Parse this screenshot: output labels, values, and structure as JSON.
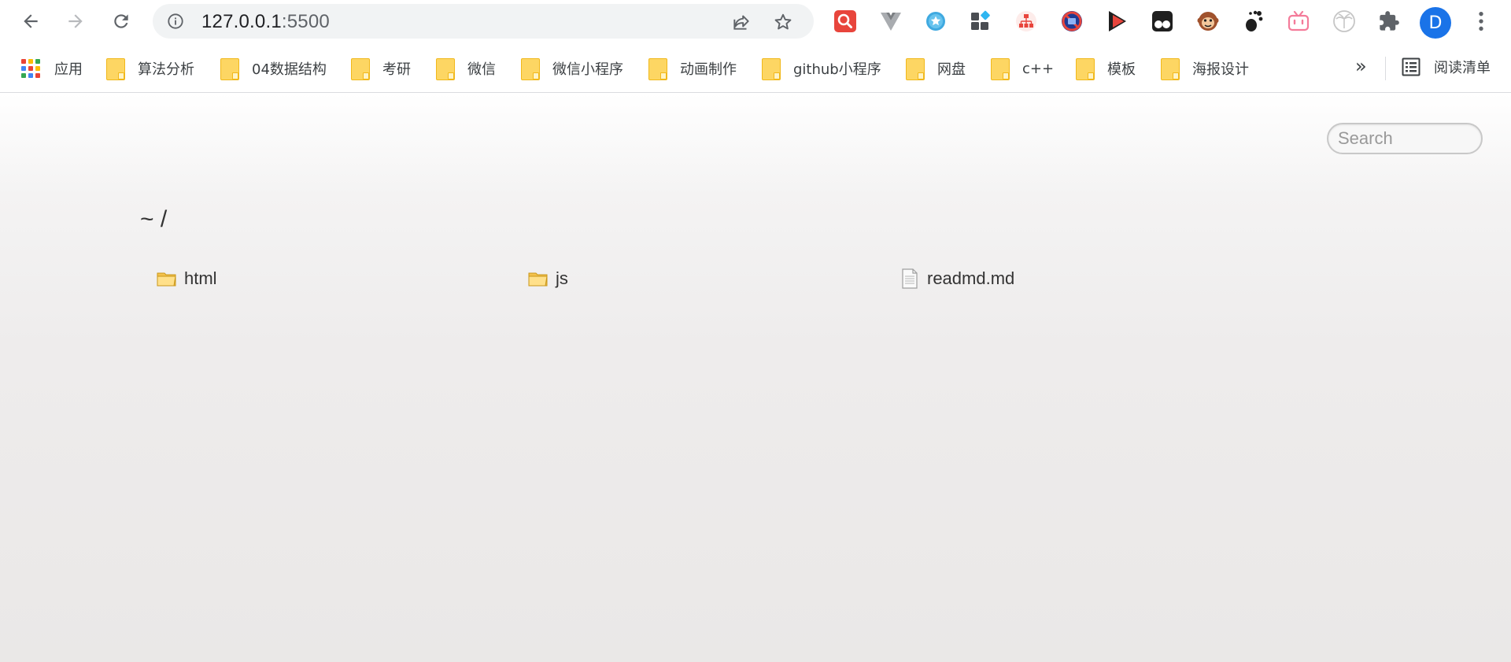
{
  "browser": {
    "url_host": "127.0.0.1",
    "url_port": ":5500",
    "avatar_letter": "D"
  },
  "bookmarks": {
    "apps_label": "应用",
    "items": [
      {
        "label": "算法分析"
      },
      {
        "label": "04数据结构"
      },
      {
        "label": "考研"
      },
      {
        "label": "微信"
      },
      {
        "label": "微信小程序"
      },
      {
        "label": "动画制作"
      },
      {
        "label": "github小程序"
      },
      {
        "label": "网盘"
      },
      {
        "label": "c++"
      },
      {
        "label": "模板"
      },
      {
        "label": "海报设计"
      }
    ],
    "more_label": "»",
    "reading_list_label": "阅读清单"
  },
  "page": {
    "search_placeholder": "Search",
    "breadcrumb": "~ /",
    "files": [
      {
        "name": "html",
        "type": "folder"
      },
      {
        "name": "js",
        "type": "folder"
      },
      {
        "name": "readmd.md",
        "type": "file"
      }
    ]
  },
  "colors": {
    "folder_fill": "#fdd663",
    "avatar_bg": "#1a73e8",
    "page_bg_bottom": "#eae8e7"
  }
}
